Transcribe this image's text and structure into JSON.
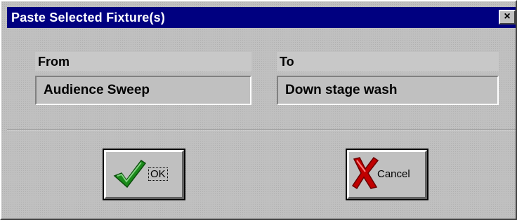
{
  "window": {
    "title": "Paste Selected Fixture(s)",
    "close_glyph": "×"
  },
  "from": {
    "label": "From",
    "value": "Audience Sweep"
  },
  "to": {
    "label": "To",
    "value": "Down stage wash"
  },
  "buttons": {
    "ok": {
      "label": "OK",
      "icon": "checkmark-icon",
      "color": "#1a8a1a"
    },
    "cancel": {
      "label": "Cancel",
      "icon": "x-cross-icon",
      "color": "#c00000"
    }
  },
  "colors": {
    "titlebar": "#000080",
    "face": "#c0c0c0"
  }
}
